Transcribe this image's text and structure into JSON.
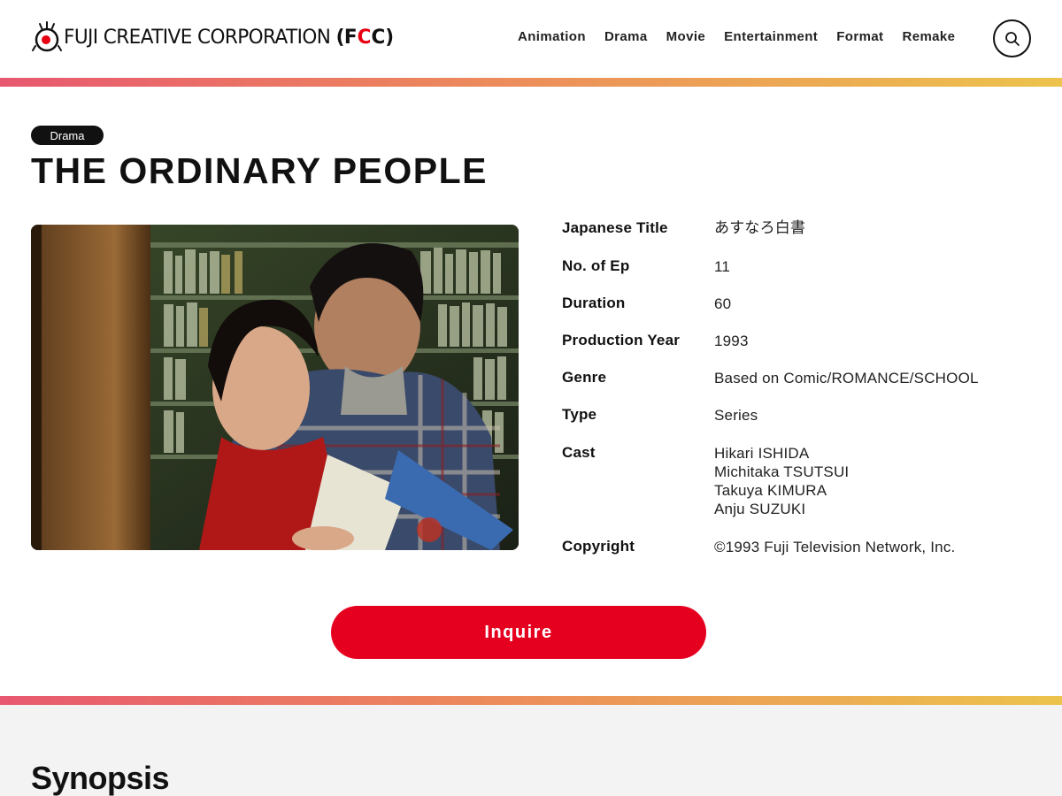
{
  "header": {
    "logo_text": "FUJI CREATIVE CORPORATION",
    "logo_abbr_open": "(",
    "logo_abbr_f": "F",
    "logo_abbr_c1": "C",
    "logo_abbr_c2": "C",
    "logo_abbr_close": ")",
    "nav": [
      "Animation",
      "Drama",
      "Movie",
      "Entertainment",
      "Format",
      "Remake"
    ],
    "search_icon": "search-icon"
  },
  "colors": {
    "accent": "#e60020",
    "gradient_start": "#e85870",
    "gradient_mid": "#ec8a5c",
    "gradient_end": "#ecc34c"
  },
  "main": {
    "category": "Drama",
    "title": "THE ORDINARY PEOPLE",
    "details": {
      "japanese_title": {
        "label": "Japanese Title",
        "value": "あすなろ白書"
      },
      "episodes": {
        "label": "No. of Ep",
        "value": "11"
      },
      "duration": {
        "label": "Duration",
        "value": "60"
      },
      "production_year": {
        "label": "Production Year",
        "value": "1993"
      },
      "genre": {
        "label": "Genre",
        "value": "Based on Comic/ROMANCE/SCHOOL"
      },
      "type": {
        "label": "Type",
        "value": "Series"
      },
      "cast": {
        "label": "Cast",
        "values": [
          "Hikari ISHIDA",
          "Michitaka TSUTSUI",
          "Takuya KIMURA",
          "Anju SUZUKI"
        ]
      },
      "copyright": {
        "label": "Copyright",
        "value": "©1993 Fuji Television Network, Inc."
      }
    },
    "inquire_label": "Inquire"
  },
  "synopsis": {
    "title": "Synopsis"
  }
}
